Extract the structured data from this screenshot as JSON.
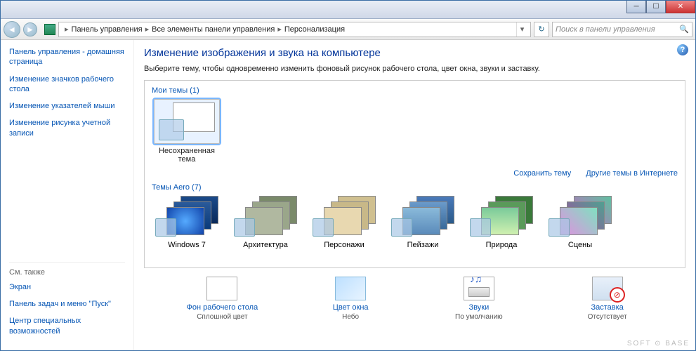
{
  "titlebar": {
    "minimize": "─",
    "maximize": "☐",
    "close": "✕"
  },
  "nav": {
    "back": "◄",
    "fwd": "►",
    "refresh": "↻"
  },
  "breadcrumb": {
    "items": [
      "Панель управления",
      "Все элементы панели управления",
      "Персонализация"
    ],
    "sep": "▸"
  },
  "search": {
    "placeholder": "Поиск в панели управления"
  },
  "sidebar": {
    "links": [
      "Панель управления - домашняя страница",
      "Изменение значков рабочего стола",
      "Изменение указателей мыши",
      "Изменение рисунка учетной записи"
    ],
    "see_also_hdr": "См. также",
    "see_also": [
      "Экран",
      "Панель задач и меню \"Пуск\"",
      "Центр специальных возможностей"
    ]
  },
  "main": {
    "title": "Изменение изображения и звука на компьютере",
    "desc": "Выберите тему, чтобы одновременно изменить фоновый рисунок рабочего стола, цвет окна, звуки и заставку.",
    "help": "?",
    "my_themes_hdr": "Мои темы (1)",
    "my_themes": [
      {
        "label": "Несохраненная тема",
        "selected": true
      }
    ],
    "save_link": "Сохранить тему",
    "online_link": "Другие темы в Интернете",
    "aero_hdr": "Темы Aero (7)",
    "aero_themes": [
      {
        "label": "Windows 7",
        "cls": "t-win7"
      },
      {
        "label": "Архитектура",
        "cls": "t-arch"
      },
      {
        "label": "Персонажи",
        "cls": "t-char"
      },
      {
        "label": "Пейзажи",
        "cls": "t-land"
      },
      {
        "label": "Природа",
        "cls": "t-nat"
      },
      {
        "label": "Сцены",
        "cls": "t-scn"
      }
    ],
    "bottom": [
      {
        "link": "Фон рабочего стола",
        "sub": "Сплошной цвет",
        "icon": "wp"
      },
      {
        "link": "Цвет окна",
        "sub": "Небо",
        "icon": "color"
      },
      {
        "link": "Звуки",
        "sub": "По умолчанию",
        "icon": "snd"
      },
      {
        "link": "Заставка",
        "sub": "Отсутствует",
        "icon": "scr"
      }
    ]
  },
  "watermark": "SOFT ⊙ BASE"
}
